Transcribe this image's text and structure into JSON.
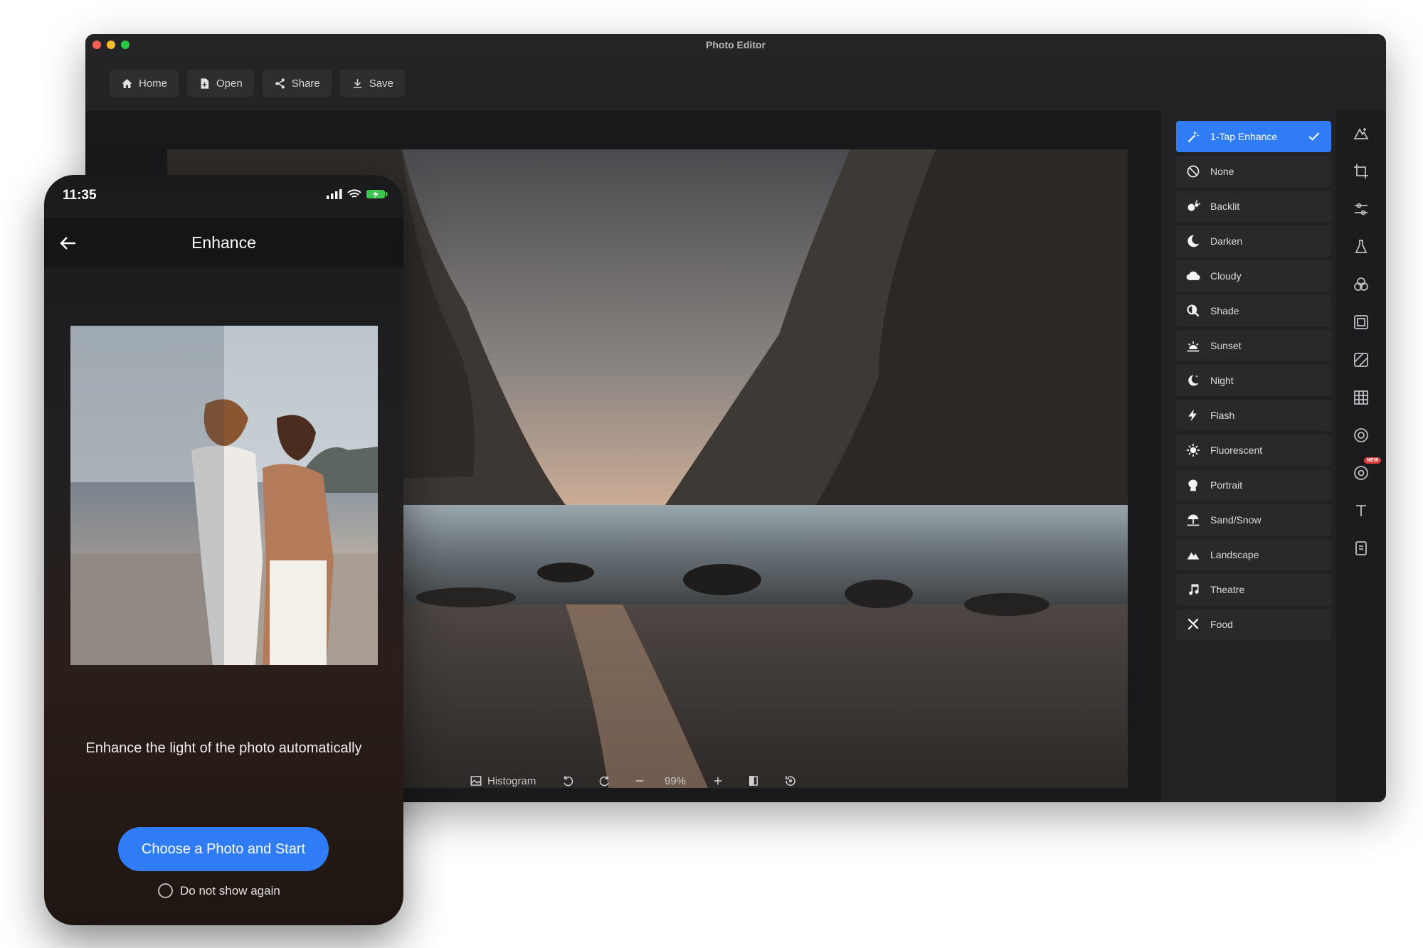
{
  "window": {
    "title": "Photo Editor"
  },
  "toolbar": {
    "buttons": [
      {
        "label": "Home",
        "icon": "home-icon"
      },
      {
        "label": "Open",
        "icon": "open-file-icon"
      },
      {
        "label": "Share",
        "icon": "share-icon"
      },
      {
        "label": "Save",
        "icon": "download-icon"
      }
    ]
  },
  "filters": {
    "items": [
      {
        "label": "1-Tap Enhance",
        "icon": "magic-wand-icon",
        "selected": true
      },
      {
        "label": "None",
        "icon": "none-icon"
      },
      {
        "label": "Backlit",
        "icon": "backlit-icon"
      },
      {
        "label": "Darken",
        "icon": "moon-icon"
      },
      {
        "label": "Cloudy",
        "icon": "cloud-icon"
      },
      {
        "label": "Shade",
        "icon": "shade-icon"
      },
      {
        "label": "Sunset",
        "icon": "sunset-icon"
      },
      {
        "label": "Night",
        "icon": "night-icon"
      },
      {
        "label": "Flash",
        "icon": "flash-icon"
      },
      {
        "label": "Fluorescent",
        "icon": "fluorescent-icon"
      },
      {
        "label": "Portrait",
        "icon": "portrait-icon"
      },
      {
        "label": "Sand/Snow",
        "icon": "beach-icon"
      },
      {
        "label": "Landscape",
        "icon": "mountain-icon"
      },
      {
        "label": "Theatre",
        "icon": "music-note-icon"
      },
      {
        "label": "Food",
        "icon": "utensils-icon"
      }
    ]
  },
  "bottom": {
    "histogram_label": "Histogram",
    "zoom": "99%"
  },
  "rail": {
    "new_badge": "NEW"
  },
  "phone": {
    "time": "11:35",
    "title": "Enhance",
    "description": "Enhance the light of the photo automatically",
    "cta_label": "Choose a Photo and Start",
    "dont_show_label": "Do not show again"
  },
  "colors": {
    "accent": "#2f7cf6",
    "window_bg": "#1c1c1e",
    "panel_bg": "#222224"
  }
}
